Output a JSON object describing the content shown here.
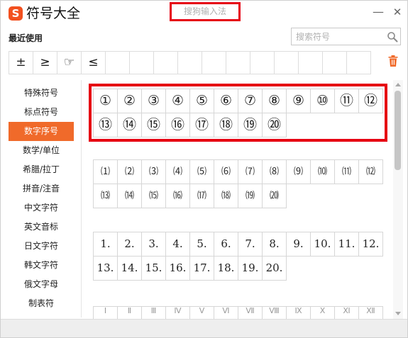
{
  "window": {
    "app_title": "符号大全",
    "logo_letter": "S",
    "ime_name": "搜狗输入法",
    "minimize_label": "—",
    "close_label": "✕"
  },
  "recent": {
    "title": "最近使用",
    "symbols": [
      "±",
      "≥",
      "☞",
      "≤",
      "",
      "",
      "",
      "",
      "",
      "",
      "",
      "",
      "",
      "",
      ""
    ]
  },
  "search": {
    "placeholder": "搜索符号",
    "value": ""
  },
  "sidebar": {
    "items": [
      {
        "label": "特殊符号"
      },
      {
        "label": "标点符号"
      },
      {
        "label": "数字序号"
      },
      {
        "label": "数学/单位"
      },
      {
        "label": "希腊/拉丁"
      },
      {
        "label": "拼音/注音"
      },
      {
        "label": "中文字符"
      },
      {
        "label": "英文音标"
      },
      {
        "label": "日文字符"
      },
      {
        "label": "韩文字符"
      },
      {
        "label": "俄文字母"
      },
      {
        "label": "制表符"
      }
    ],
    "active_index": 2
  },
  "groups": [
    {
      "name": "circled",
      "symbols": [
        "①",
        "②",
        "③",
        "④",
        "⑤",
        "⑥",
        "⑦",
        "⑧",
        "⑨",
        "⑩",
        "⑪",
        "⑫",
        "⑬",
        "⑭",
        "⑮",
        "⑯",
        "⑰",
        "⑱",
        "⑲",
        "⑳"
      ]
    },
    {
      "name": "parenthesized",
      "symbols": [
        "⑴",
        "⑵",
        "⑶",
        "⑷",
        "⑸",
        "⑹",
        "⑺",
        "⑻",
        "⑼",
        "⑽",
        "⑾",
        "⑿",
        "⒀",
        "⒁",
        "⒂",
        "⒃",
        "⒄",
        "⒅",
        "⒆",
        "⒇"
      ]
    },
    {
      "name": "full-stop",
      "symbols": [
        "1.",
        "2.",
        "3.",
        "4.",
        "5.",
        "6.",
        "7.",
        "8.",
        "9.",
        "10.",
        "11.",
        "12.",
        "13.",
        "14.",
        "15.",
        "16.",
        "17.",
        "18.",
        "19.",
        "20."
      ]
    },
    {
      "name": "roman",
      "symbols": [
        "Ⅰ",
        "Ⅱ",
        "Ⅲ",
        "Ⅳ",
        "Ⅴ",
        "Ⅵ",
        "Ⅶ",
        "Ⅷ",
        "Ⅸ",
        "Ⅹ",
        "Ⅺ",
        "Ⅻ"
      ]
    }
  ],
  "colors": {
    "accent": "#f06a2a",
    "highlight_box": "#e60012",
    "logo": "#f2501f"
  },
  "icons": {
    "search": "search-icon",
    "delete": "trash-icon"
  }
}
